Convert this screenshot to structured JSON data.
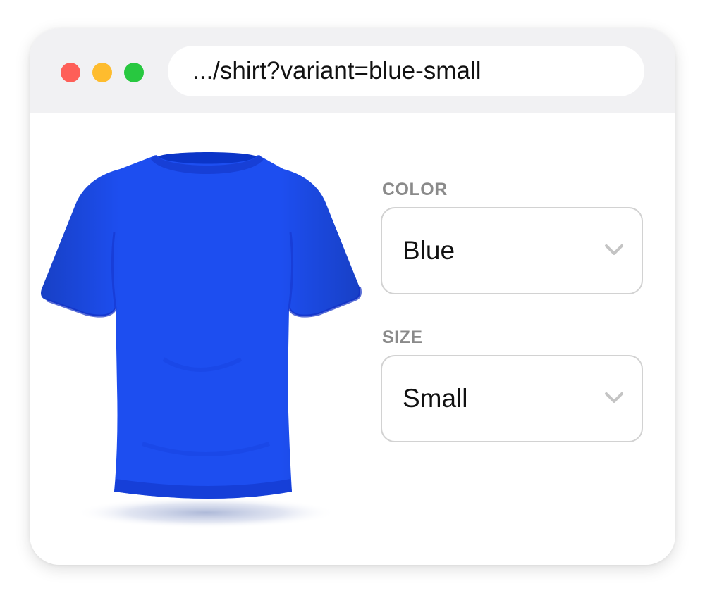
{
  "browser": {
    "url": ".../shirt?variant=blue-small",
    "window_controls": [
      {
        "name": "close",
        "color": "#fe5f58"
      },
      {
        "name": "minimize",
        "color": "#febc2e"
      },
      {
        "name": "maximize",
        "color": "#28c840"
      }
    ]
  },
  "product": {
    "image_icon": "tshirt-image",
    "shirt_color": "#1d4ef0"
  },
  "options": {
    "color": {
      "label": "COLOR",
      "selected": "Blue",
      "icon": "chevron-down-icon"
    },
    "size": {
      "label": "SIZE",
      "selected": "Small",
      "icon": "chevron-down-icon"
    }
  }
}
